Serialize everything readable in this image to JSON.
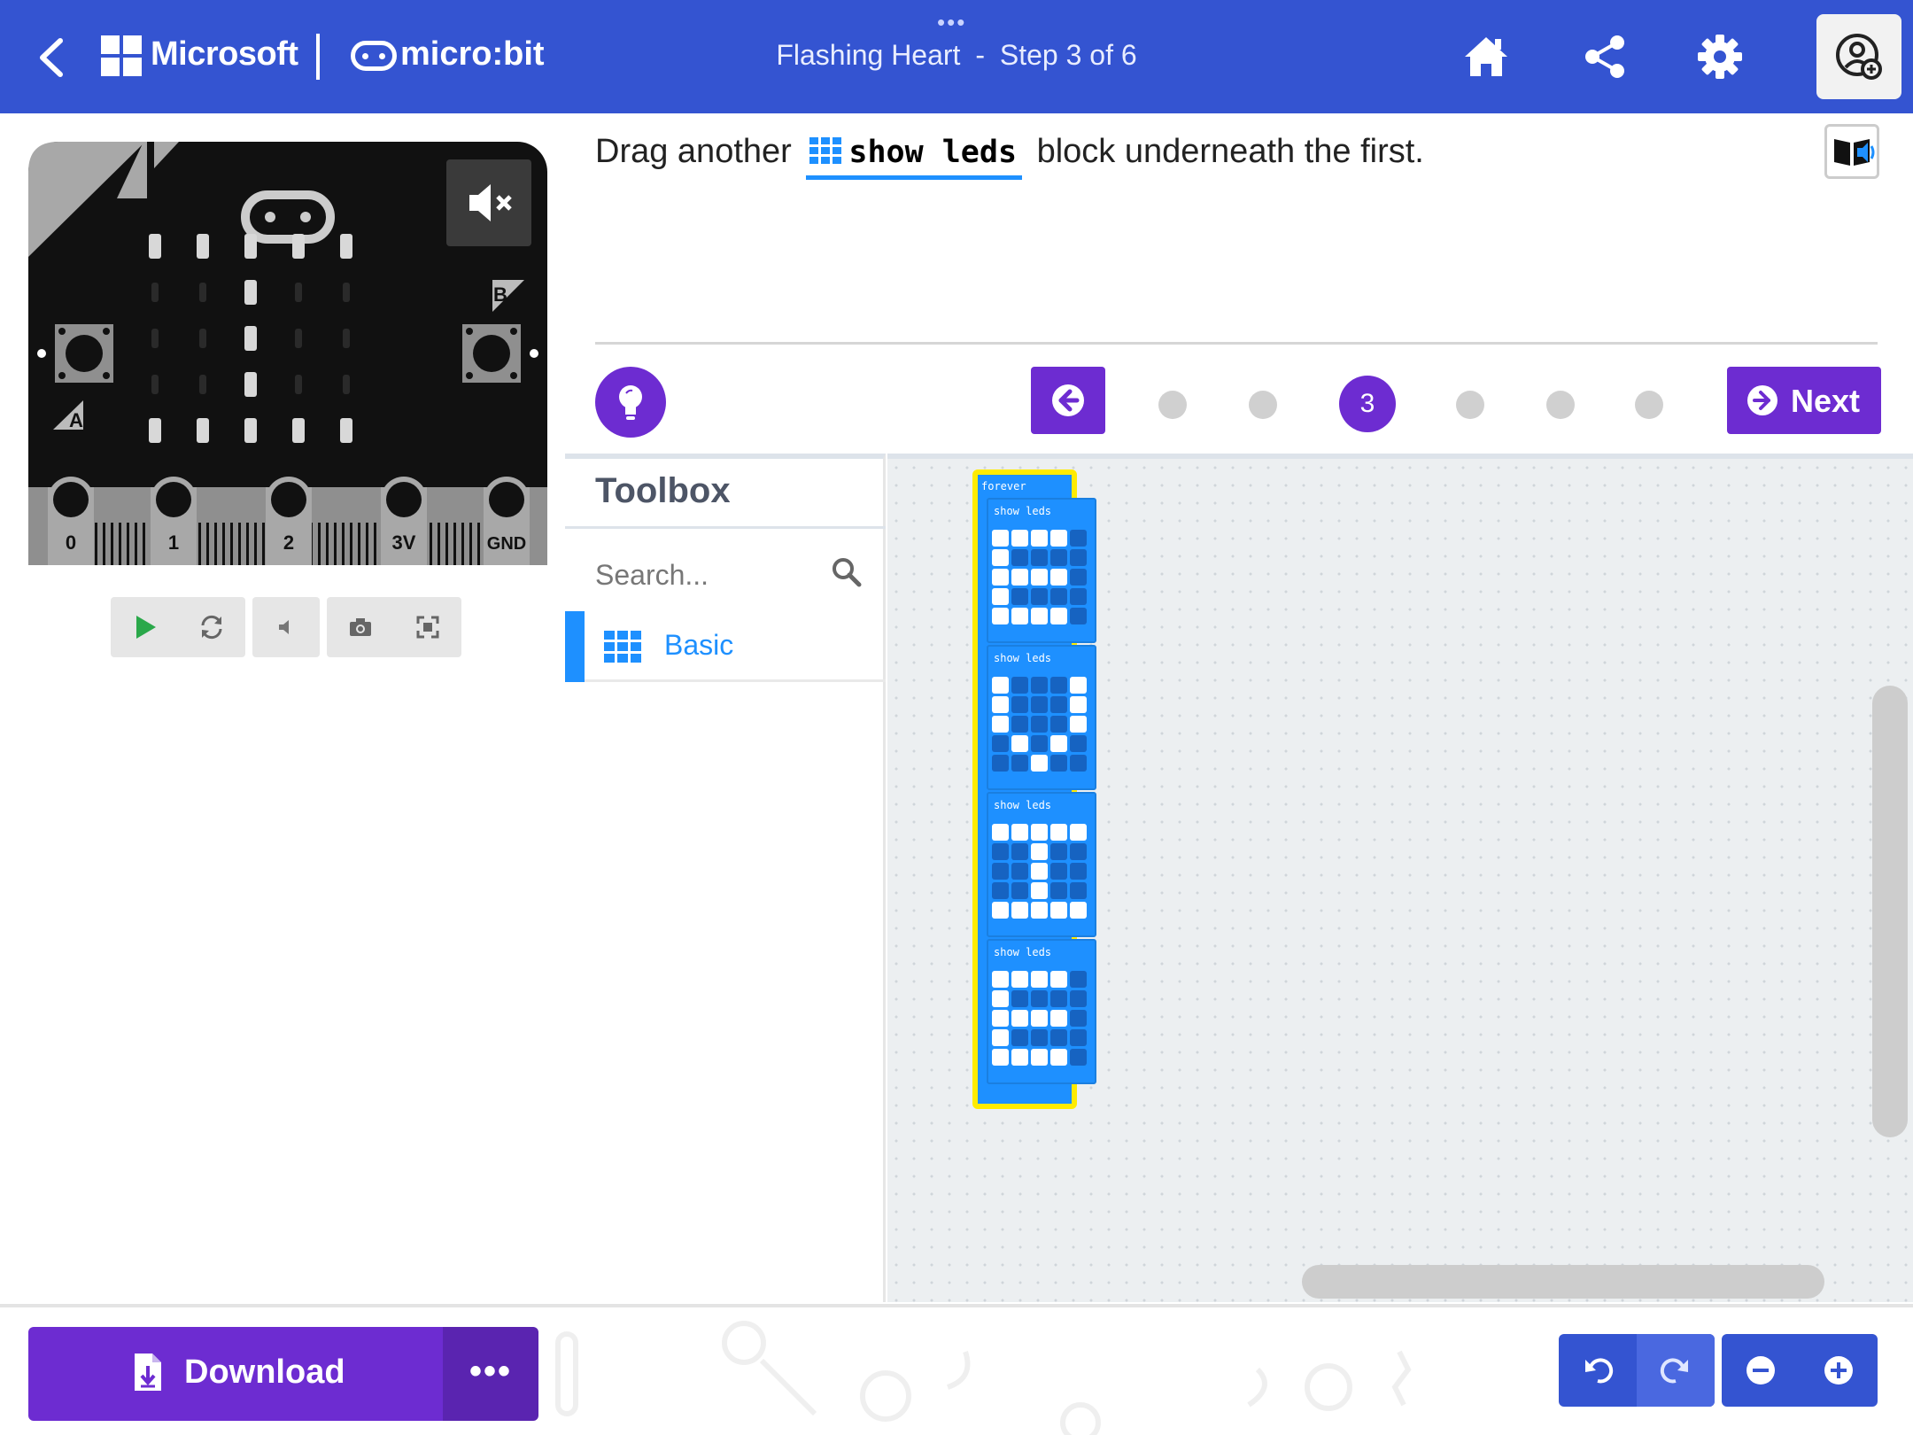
{
  "header": {
    "brand": "Microsoft",
    "product": "micro:bit",
    "tutorial_name": "Flashing Heart",
    "separator": "-",
    "step_text": "Step 3 of 6",
    "bg_color": "#3454d1"
  },
  "simulator": {
    "pin_labels": [
      "0",
      "1",
      "2",
      "3V",
      "GND"
    ],
    "button_a": "A",
    "button_b": "B",
    "display_rows": [
      [
        1,
        1,
        1,
        1,
        1
      ],
      [
        0,
        0,
        1,
        0,
        0
      ],
      [
        0,
        0,
        1,
        0,
        0
      ],
      [
        0,
        0,
        1,
        0,
        0
      ],
      [
        1,
        1,
        1,
        1,
        1
      ]
    ]
  },
  "tutorial": {
    "instruction_before": "Drag another",
    "instruction_block": "show leds",
    "instruction_after": "block underneath the first.",
    "current_step": "3",
    "next_label": "Next",
    "accent_color": "#6d2cd1"
  },
  "toolbox": {
    "title": "Toolbox",
    "search_placeholder": "Search...",
    "categories": [
      {
        "label": "Basic",
        "color": "#1e90ff"
      }
    ]
  },
  "workspace": {
    "forever_label": "forever",
    "blocks": [
      {
        "label": "show leds",
        "leds": [
          [
            1,
            1,
            1,
            1,
            0
          ],
          [
            1,
            0,
            0,
            0,
            0
          ],
          [
            1,
            1,
            1,
            1,
            0
          ],
          [
            1,
            0,
            0,
            0,
            0
          ],
          [
            1,
            1,
            1,
            1,
            0
          ]
        ]
      },
      {
        "label": "show leds",
        "leds": [
          [
            1,
            0,
            0,
            0,
            1
          ],
          [
            1,
            0,
            0,
            0,
            1
          ],
          [
            1,
            0,
            0,
            0,
            1
          ],
          [
            0,
            1,
            0,
            1,
            0
          ],
          [
            0,
            0,
            1,
            0,
            0
          ]
        ]
      },
      {
        "label": "show leds",
        "leds": [
          [
            1,
            1,
            1,
            1,
            1
          ],
          [
            0,
            0,
            1,
            0,
            0
          ],
          [
            0,
            0,
            1,
            0,
            0
          ],
          [
            0,
            0,
            1,
            0,
            0
          ],
          [
            1,
            1,
            1,
            1,
            1
          ]
        ]
      },
      {
        "label": "show leds",
        "leds": [
          [
            1,
            1,
            1,
            1,
            0
          ],
          [
            1,
            0,
            0,
            0,
            0
          ],
          [
            1,
            1,
            1,
            1,
            0
          ],
          [
            1,
            0,
            0,
            0,
            0
          ],
          [
            1,
            1,
            1,
            1,
            0
          ]
        ]
      }
    ]
  },
  "footer": {
    "download_label": "Download",
    "more_label": "•••"
  }
}
